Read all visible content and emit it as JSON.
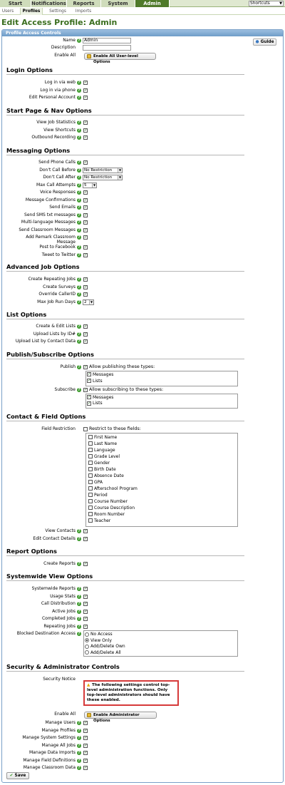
{
  "nav": {
    "tabs": [
      "Start",
      "Notifications",
      "Reports",
      "System",
      "Admin"
    ],
    "active_tab": "Admin",
    "shortcuts": "Shortcuts"
  },
  "subnav": {
    "tabs": [
      "Users",
      "Profiles",
      "Settings",
      "Imports"
    ],
    "active_tab": "Profiles"
  },
  "page_title": "Edit Access Profile: Admin",
  "panel_title": "Profile Access Controls",
  "guide_label": "Guide",
  "form": {
    "name_label": "Name",
    "name_value": "Admin",
    "description_label": "Description",
    "description_value": "",
    "enable_all_label": "Enable All",
    "enable_all_button": "Enable All User-level Options"
  },
  "sections": {
    "login": {
      "title": "Login Options",
      "items": [
        "Log in via web",
        "Log in via phone",
        "Edit Personal Account"
      ]
    },
    "start": {
      "title": "Start Page & Nav Options",
      "items": [
        "View Job Statistics",
        "View Shortcuts",
        "Outbound Recording"
      ]
    },
    "messaging": {
      "title": "Messaging Options",
      "send_phone": "Send Phone Calls",
      "dont_before": "Don't Call Before",
      "dont_before_value": "No Restriction",
      "dont_after": "Don't Call After",
      "dont_after_value": "No Restriction",
      "max_attempts": "Max Call Attempts",
      "max_attempts_value": "5",
      "items": [
        "Voice Responses",
        "Message Confirmations",
        "Send Emails",
        "Send SMS txt messages",
        "Multi-language Messages",
        "Send Classroom Messages",
        "Add Remark Classroom Message",
        "Post to Facebook",
        "Tweet to Twitter"
      ]
    },
    "advanced": {
      "title": "Advanced Job Options",
      "items": [
        "Create Repeating Jobs",
        "Create Surveys",
        "Override CallerID"
      ],
      "max_days": "Max Job Run Days",
      "max_days_value": "2"
    },
    "list": {
      "title": "List Options",
      "items": [
        "Create & Edit Lists",
        "Upload Lists by ID#",
        "Upload List by Contact Data"
      ]
    },
    "publish": {
      "title": "Publish/Subscribe Options",
      "publish_label": "Publish",
      "publish_text": "Allow publishing these types:",
      "subscribe_label": "Subscribe",
      "subscribe_text": "Allow subscribing to these types:",
      "types": [
        "Messages",
        "Lists"
      ]
    },
    "contact": {
      "title": "Contact & Field Options",
      "field_restriction": "Field Restriction",
      "restrict_text": "Restrict to these fields:",
      "fields": [
        "First Name",
        "Last Name",
        "Language",
        "Grade Level",
        "Gender",
        "Birth Date",
        "Absence Date",
        "GPA",
        "Afterschool Program",
        "Period",
        "Course Number",
        "Course Description",
        "Room Number",
        "Teacher"
      ],
      "items": [
        "View Contacts",
        "Edit Contact Details"
      ]
    },
    "report": {
      "title": "Report Options",
      "items": [
        "Create Reports"
      ]
    },
    "systemwide": {
      "title": "Systemwide View Options",
      "items": [
        "Systemwide Reports",
        "Usage Stats",
        "Call Distribution",
        "Active Jobs",
        "Completed Jobs",
        "Repeating Jobs"
      ],
      "blocked_label": "Blocked Destination Access",
      "blocked_options": [
        "No Access",
        "View Only",
        "Add/Delete Own",
        "Add/Delete All"
      ],
      "blocked_selected": "View Only"
    },
    "security": {
      "title": "Security & Administrator Controls",
      "notice_label": "Security Notice",
      "notice_text": "The following settings control top-level administration functions. Only top-level administrators should have these enabled.",
      "enable_all_label": "Enable All",
      "enable_all_button": "Enable Administrator Options",
      "items": [
        "Manage Users",
        "Manage Profiles",
        "Manage System Settings",
        "Manage All Jobs",
        "Manage Data Imports",
        "Manage Field Definitions",
        "Manage Classroom Data"
      ]
    }
  },
  "save_label": "Save"
}
